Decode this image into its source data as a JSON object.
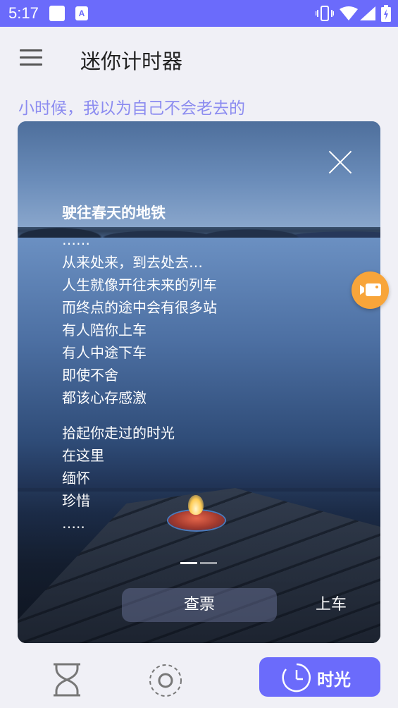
{
  "status_bar": {
    "time": "5:17",
    "icons": [
      "notification-square-icon",
      "a-app-icon",
      "vibrate-icon",
      "wifi-icon",
      "signal-icon",
      "battery-icon"
    ]
  },
  "app_bar": {
    "title": "迷你计时器",
    "menu_icon": "hamburger-menu-icon"
  },
  "subtitle": "小时候，我以为自己不会老去的",
  "card": {
    "poem_title": "驶往春天的地铁",
    "lines_1": [
      "……",
      "从来处来，到去处去…",
      "人生就像开往未来的列车",
      "而终点的途中会有很多站",
      "有人陪你上车",
      "有人中途下车",
      "即使不舍",
      "都该心存感激"
    ],
    "lines_2": [
      "拾起你走过的时光",
      "在这里",
      "缅怀",
      "珍惜",
      "….."
    ],
    "pager": {
      "total": 2,
      "current": 1
    },
    "check_ticket_label": "查票",
    "board_label": "上车"
  },
  "fab_icon": "video-camera-icon",
  "bottom_nav": {
    "items": [
      {
        "icon": "hourglass-icon",
        "label": ""
      },
      {
        "icon": "dashed-circle-icon",
        "label": ""
      },
      {
        "icon": "clock-icon",
        "label": "时光",
        "active": true
      }
    ]
  },
  "colors": {
    "accent": "#6b6bfb",
    "subtitle": "#8c8cf0",
    "fab": "#f8a53a"
  }
}
